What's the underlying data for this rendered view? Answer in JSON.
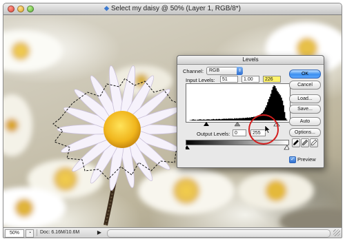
{
  "document_window": {
    "title": "Select my daisy @ 50% (Layer 1, RGB/8*)",
    "zoom": "50%",
    "doc_info": "Doc: 6.16M/10.6M",
    "status_arrow": "▶",
    "app_icon": "photoshop-icon"
  },
  "levels_dialog": {
    "title": "Levels",
    "channel_label": "Channel:",
    "channel_value": "RGB",
    "input_levels_label": "Input Levels:",
    "input_black": "51",
    "input_gamma": "1.00",
    "input_white": "226",
    "output_levels_label": "Output Levels:",
    "output_black": "0",
    "output_white": "255",
    "buttons": {
      "ok": "OK",
      "cancel": "Cancel",
      "load": "Load...",
      "save": "Save...",
      "auto": "Auto",
      "options": "Options..."
    },
    "preview_label": "Preview",
    "preview_checked": true,
    "eyedroppers": [
      "black-eyedropper-icon",
      "gray-eyedropper-icon",
      "white-eyedropper-icon"
    ],
    "histogram": [
      0,
      0,
      0,
      1,
      1,
      2,
      3,
      2,
      2,
      1,
      2,
      2,
      3,
      3,
      2,
      2,
      3,
      2,
      2,
      3,
      3,
      3,
      2,
      3,
      3,
      4,
      3,
      3,
      4,
      3,
      4,
      4,
      3,
      4,
      4,
      5,
      4,
      5,
      4,
      5,
      5,
      5,
      5,
      5,
      4,
      6,
      5,
      6,
      5,
      6,
      6,
      6,
      6,
      7,
      6,
      7,
      7,
      8,
      7,
      8,
      8,
      9,
      9,
      10,
      10,
      11,
      12,
      13,
      14,
      16,
      18,
      20,
      24,
      28,
      34,
      40,
      48,
      56,
      62,
      70,
      80,
      88,
      92,
      90,
      84,
      78,
      74,
      70,
      66,
      60,
      52,
      40,
      22,
      6,
      2,
      0
    ],
    "accent_color": "#3b8ff0",
    "highlight_color": "#fff36a",
    "annotation_color": "#d41e1e"
  }
}
